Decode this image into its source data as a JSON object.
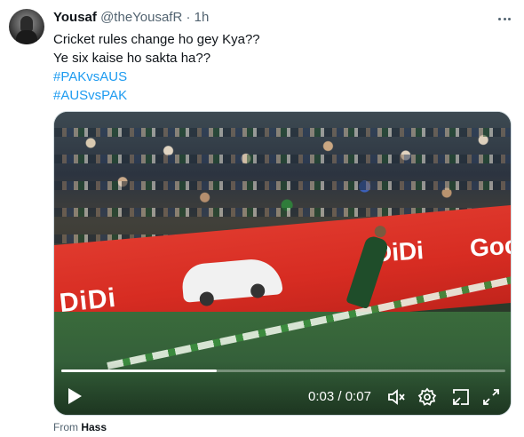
{
  "tweet": {
    "author_name": "Yousaf",
    "author_handle": "@theYousafR",
    "separator": "·",
    "time": "1h",
    "lines": [
      "Cricket rules change ho gey Kya??",
      "Ye six kaise ho sakta ha??"
    ],
    "hashtags": [
      "#PAKvsAUS",
      "#AUSvsPAK"
    ]
  },
  "video": {
    "current_time": "0:03",
    "duration": "0:07",
    "time_sep": " / ",
    "progress": 0.35,
    "board_text_left": "DiDi",
    "board_text_center": "DiDi",
    "board_text_right": "Goc"
  },
  "icons": [
    "more-icon",
    "play-icon",
    "mute-icon",
    "settings-icon",
    "pip-icon",
    "fullscreen-icon"
  ],
  "footer": {
    "prefix": "From",
    "source": "Hass"
  },
  "colors": {
    "accent": "#1d9bf0",
    "text": "#0f1419",
    "muted": "#536471"
  }
}
